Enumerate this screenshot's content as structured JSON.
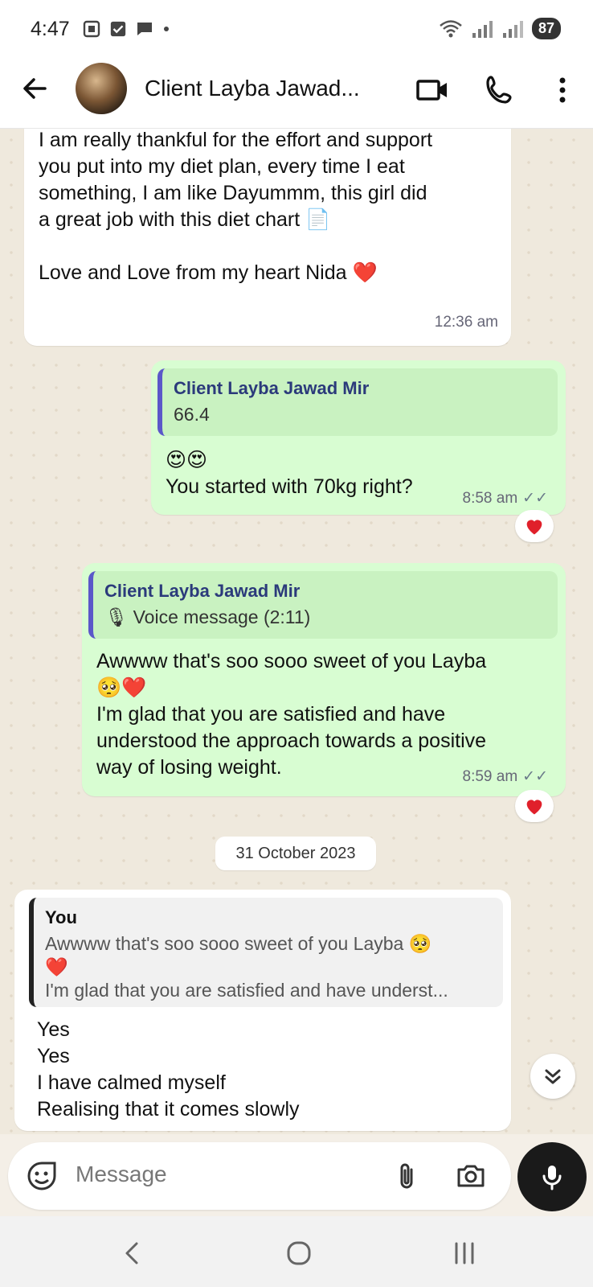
{
  "status_bar": {
    "time": "4:47",
    "battery": "87"
  },
  "header": {
    "title": "Client Layba Jawad...",
    "icons": [
      "back-arrow-icon",
      "video-call-icon",
      "voice-call-icon",
      "more-options-icon"
    ]
  },
  "messages": [
    {
      "direction": "in",
      "text": "I am really thankful for the effort and support\nyou put into my diet plan, every time I eat\nsomething, I am like Dayummm, this girl did\na great job with this diet chart 📄\n\nLove and Love from my heart Nida ❤️",
      "time": "12:36 am"
    },
    {
      "direction": "out",
      "quote_name": "Client Layba Jawad Mir",
      "quote_text": "66.4",
      "text": "😍😍\nYou started with 70kg right?",
      "time": "8:58 am",
      "reaction": "❤️"
    },
    {
      "direction": "out",
      "quote_name": "Client Layba Jawad Mir",
      "quote_text": "🎙 Voice message (2:11)",
      "text": "Awwww that's soo sooo sweet of you Layba\n🥺❤️\nI'm glad that you are satisfied and have\nunderstood the approach towards a positive\nway of losing weight.",
      "time": "8:59 am",
      "reaction": "❤️"
    }
  ],
  "date_separator": "31 October 2023",
  "last_message": {
    "direction": "in",
    "quote_name": "You",
    "quote_line1": "Awwww that's soo sooo sweet of you Layba 🥺",
    "quote_line2": "❤️",
    "quote_line3": "I'm glad that you are satisfied and have underst...",
    "text": "Yes\nYes\nI have calmed myself\nRealising that it comes slowly"
  },
  "composer": {
    "placeholder": "Message"
  },
  "colors": {
    "incoming_bubble": "#ffffff",
    "outgoing_bubble": "#d8fdd2",
    "quote_bar": "#5b57c9",
    "heart": "#e0202b"
  }
}
